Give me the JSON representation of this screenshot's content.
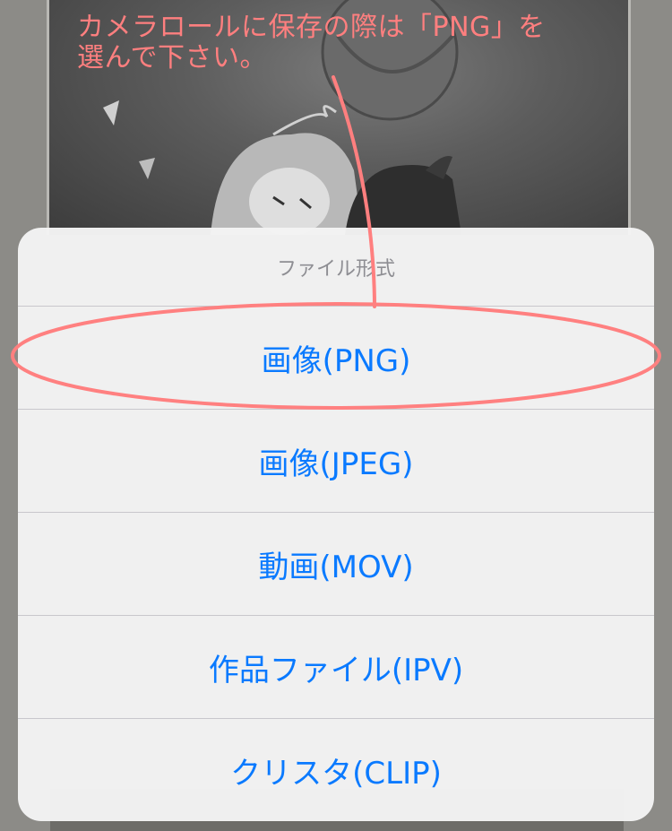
{
  "annotation": {
    "text": "カメラロールに保存の際は「PNG」を\n選んで下さい。",
    "color": "#ff7f7f"
  },
  "action_sheet": {
    "title": "ファイル形式",
    "options": [
      {
        "label": "画像(PNG)"
      },
      {
        "label": "画像(JPEG)"
      },
      {
        "label": "動画(MOV)"
      },
      {
        "label": "作品ファイル(IPV)"
      },
      {
        "label": "クリスタ(CLIP)"
      }
    ],
    "option_color": "#0a7aff",
    "title_color": "#8e8e93"
  }
}
